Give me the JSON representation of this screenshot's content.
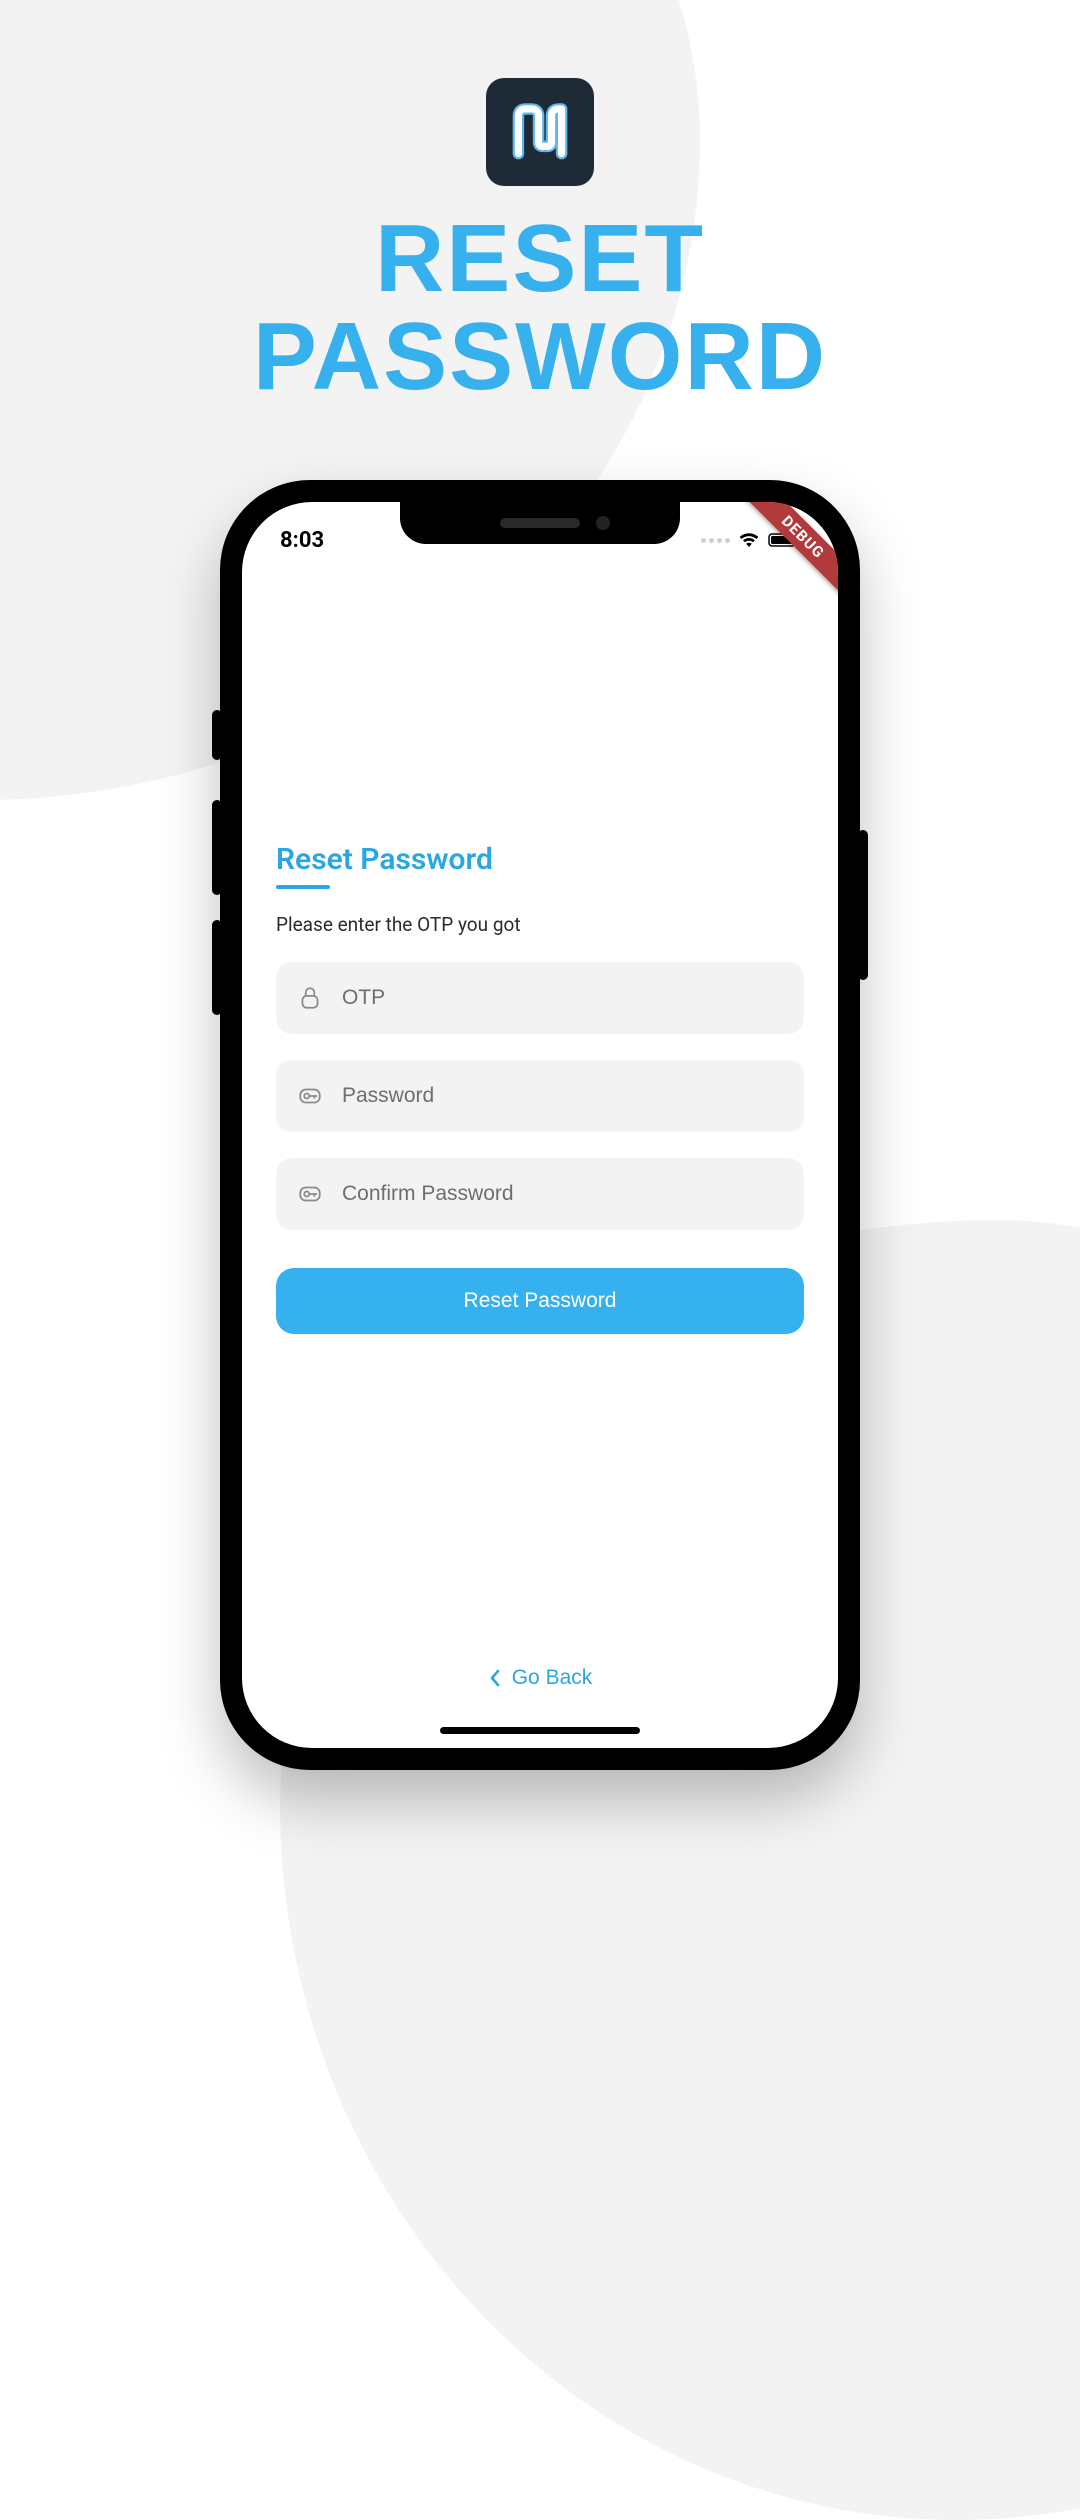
{
  "hero": {
    "title": "RESET\nPASSWORD"
  },
  "logo": {
    "name": "app-logo"
  },
  "colors": {
    "accent": "#37b0ee",
    "logo_bg": "#1e2a36",
    "field_bg": "#f3f3f3"
  },
  "status_bar": {
    "time": "8:03"
  },
  "debug_ribbon": {
    "label": "DEBUG"
  },
  "form": {
    "title": "Reset Password",
    "subtitle": "Please enter the OTP you got",
    "fields": {
      "otp": {
        "placeholder": "OTP",
        "icon": "lock-icon",
        "value": ""
      },
      "pw": {
        "placeholder": "Password",
        "icon": "key-icon",
        "value": ""
      },
      "confirm": {
        "placeholder": "Confirm Password",
        "icon": "key-icon",
        "value": ""
      }
    },
    "submit_label": "Reset Password"
  },
  "go_back": {
    "label": "Go Back"
  }
}
